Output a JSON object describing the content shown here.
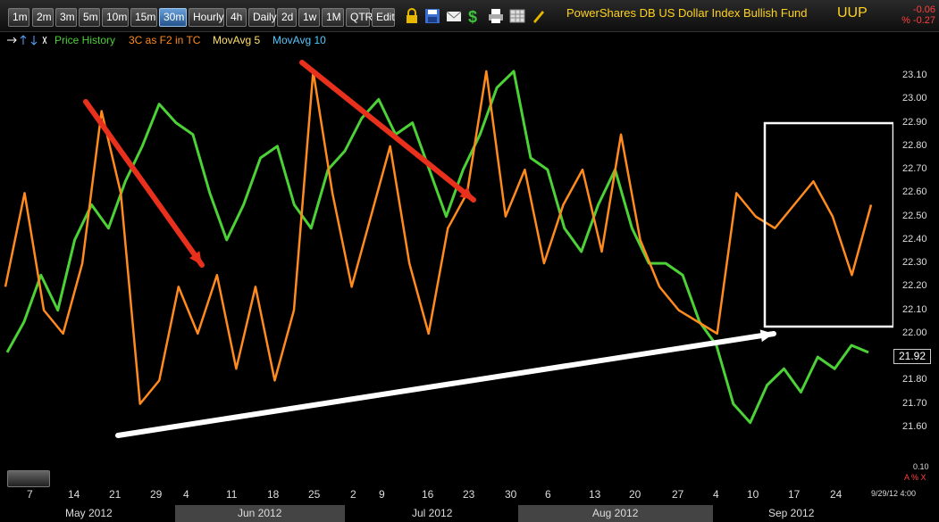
{
  "toolbar": {
    "timeframes": [
      "1m",
      "2m",
      "3m",
      "5m",
      "10m",
      "15m",
      "30m",
      "Hourly",
      "4h",
      "Daily",
      "2d",
      "1w",
      "1M",
      "QTR",
      "Edit"
    ],
    "active_timeframe": "30m",
    "icons": [
      "lock-icon",
      "save-icon",
      "email-icon",
      "dollar-icon",
      "print-icon",
      "grid-icon",
      "pencil-icon"
    ],
    "title": "PowerShares DB US Dollar Index Bullish Fund",
    "symbol": "UUP",
    "change": "-0.06",
    "change_pct": "% -0.27"
  },
  "legend": {
    "price_history": "Price History",
    "indicator": "3C as F2 in TC",
    "movavg5": "MovAvg 5",
    "movavg10": "MovAvg 10",
    "colors": {
      "price": "#4cd137",
      "indicator": "#ff8a1e",
      "movavg5": "#ffe066",
      "movavg10": "#54c8ff"
    }
  },
  "chart_data": {
    "type": "line",
    "series": [
      {
        "name": "Price History",
        "color": "#4cd137",
        "values": [
          21.92,
          22.05,
          22.25,
          22.1,
          22.4,
          22.55,
          22.45,
          22.65,
          22.8,
          22.98,
          22.9,
          22.85,
          22.6,
          22.4,
          22.55,
          22.75,
          22.8,
          22.55,
          22.45,
          22.7,
          22.78,
          22.92,
          23.0,
          22.85,
          22.9,
          22.7,
          22.5,
          22.7,
          22.85,
          23.05,
          23.12,
          22.75,
          22.7,
          22.45,
          22.35,
          22.55,
          22.7,
          22.45,
          22.3,
          22.3,
          22.25,
          22.05,
          21.95,
          21.7,
          21.62,
          21.78,
          21.85,
          21.75,
          21.9,
          21.85,
          21.95,
          21.92
        ]
      },
      {
        "name": "3C as F2 in TC",
        "color": "#ff8a1e",
        "values": [
          22.2,
          22.6,
          22.1,
          22.0,
          22.3,
          22.95,
          22.6,
          21.7,
          21.8,
          22.2,
          22.0,
          22.25,
          21.85,
          22.2,
          21.8,
          22.1,
          23.12,
          22.6,
          22.2,
          22.5,
          22.8,
          22.3,
          22.0,
          22.45,
          22.6,
          23.12,
          22.5,
          22.7,
          22.3,
          22.55,
          22.7,
          22.35,
          22.85,
          22.4,
          22.2,
          22.1,
          22.05,
          22.0,
          22.6,
          22.5,
          22.45,
          22.55,
          22.65,
          22.5,
          22.25,
          22.55
        ]
      }
    ],
    "x_ticks": [
      "7",
      "14",
      "21",
      "29",
      "4",
      "11",
      "18",
      "25",
      "2",
      "9",
      "16",
      "23",
      "30",
      "6",
      "13",
      "20",
      "27",
      "4",
      "10",
      "17",
      "24"
    ],
    "months": [
      "May 2012",
      "Jun 2012",
      "Jul 2012",
      "Aug 2012",
      "Sep 2012"
    ],
    "y_ticks": [
      "23.10",
      "23.00",
      "22.90",
      "22.80",
      "22.70",
      "22.60",
      "22.50",
      "22.40",
      "22.30",
      "22.20",
      "22.10",
      "22.00",
      "21.80",
      "21.70",
      "21.60"
    ],
    "ylim": [
      21.55,
      23.15
    ],
    "last_price": "21.92"
  },
  "footer": {
    "timestamp": "9/29/12 4:00",
    "indicator_value": "0.10",
    "indicator_ax": "A % X"
  }
}
